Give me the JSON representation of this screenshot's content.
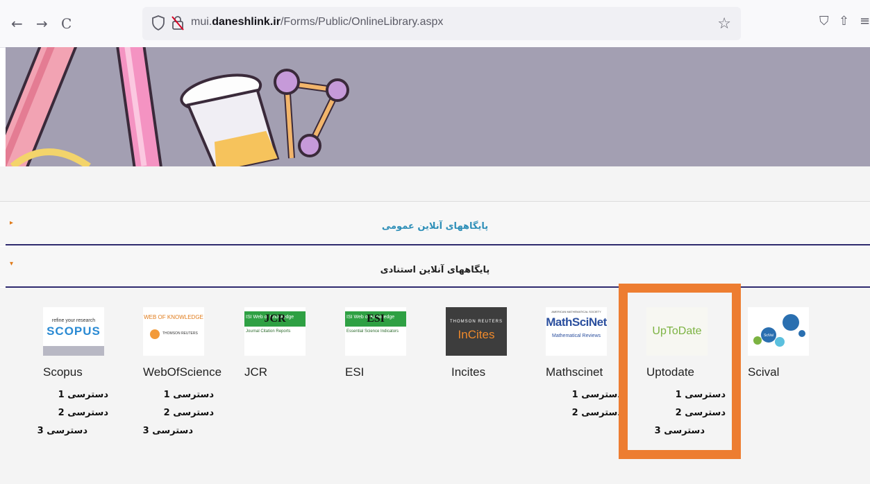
{
  "browser": {
    "back_glyph": "←",
    "forward_glyph": "→",
    "reload_glyph": "C",
    "url_host_prefix": "mui.",
    "url_host_domain": "daneshlink.ir",
    "url_path": "/Forms/Public/OnlineLibrary.aspx",
    "star_glyph": "☆",
    "pocket_glyph": "⛉",
    "share_glyph": "⇧",
    "menu_glyph": "≡"
  },
  "accordion": {
    "general_title": "پایگاههای آنلاین عمومی",
    "citation_title": "پایگاههای آنلاین استنادی",
    "collapsed_arrow": "▸",
    "expanded_arrow": "▾"
  },
  "databases": [
    {
      "name": "Scopus",
      "logo_top": "refine your research",
      "logo_main": "SCOPUS",
      "links": [
        "دسترسی 1",
        "دسترسی 2",
        "دسترسی 3"
      ]
    },
    {
      "name": "WebOfScience",
      "logo_top": "WEB OF KNOWLEDGE",
      "logo_main": "THOMSON REUTERS",
      "links": [
        "دسترسی 1",
        "دسترسی 2",
        "دسترسی 3"
      ]
    },
    {
      "name": "JCR",
      "logo_top": "ISI Web of Knowledge",
      "logo_main": "JCR",
      "logo_sub": "Journal Citation Reports",
      "links": []
    },
    {
      "name": "ESI",
      "logo_top": "ISI Web of Knowledge",
      "logo_main": "ESI",
      "logo_sub": "Essential Science Indicators",
      "links": []
    },
    {
      "name": "Incites",
      "logo_top": "THOMSON REUTERS",
      "logo_main": "InCites",
      "links": []
    },
    {
      "name": "Mathscinet",
      "logo_top": "AMERICAN MATHEMATICAL SOCIETY",
      "logo_main": "MathSciNet",
      "logo_sub": "Mathematical Reviews",
      "links": [
        "دسترسی 1",
        "دسترسی 2"
      ]
    },
    {
      "name": "Uptodate",
      "logo_main": "UpToDate",
      "links": [
        "دسترسی 1",
        "دسترسی 2",
        "دسترسی 3"
      ]
    },
    {
      "name": "Scival",
      "logo_main": "SciVal",
      "links": []
    }
  ],
  "colors": {
    "highlight": "#ed7d31",
    "banner": "#a39fb2",
    "divider": "#2e2a6e"
  }
}
